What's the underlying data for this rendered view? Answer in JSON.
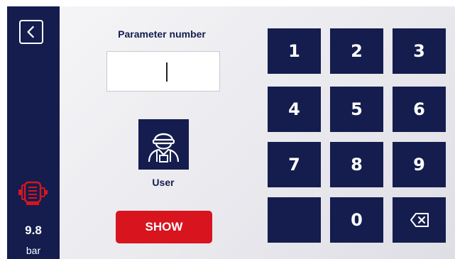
{
  "sidebar": {
    "back_icon": "chevron-left-icon",
    "status_icon": "motor-icon",
    "status_icon_color": "#d8141e",
    "pressure_value": "9.8",
    "pressure_unit": "bar"
  },
  "form": {
    "parameter_label": "Parameter number",
    "parameter_value": "",
    "user_icon": "user-worker-icon",
    "user_label": "User",
    "show_label": "SHOW"
  },
  "keypad": {
    "keys": [
      "1",
      "2",
      "3",
      "4",
      "5",
      "6",
      "7",
      "8",
      "9",
      "",
      "0"
    ],
    "backspace_icon": "backspace-icon"
  },
  "colors": {
    "navy": "#141d4e",
    "accent_red": "#d8141e",
    "background": "#ececf0"
  }
}
